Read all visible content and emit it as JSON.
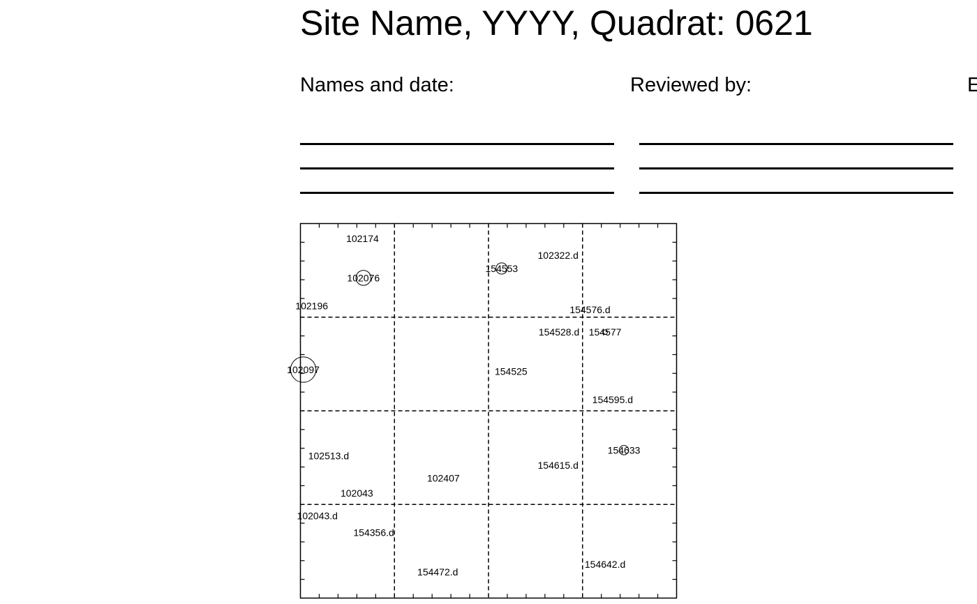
{
  "header": {
    "title": "Site Name, YYYY, Quadrat: 0621",
    "names_label": "Names and date:",
    "reviewed_label": "Reviewed by:",
    "third_label_partial": "E"
  },
  "quadrat_map": {
    "extent": [
      0,
      20
    ],
    "cell_size": 5,
    "tick_spacing": 1,
    "grid_line_style": "dashed",
    "trees": [
      {
        "tag": "102174",
        "x": 3.3,
        "y": 19.2,
        "dbh": 0
      },
      {
        "tag": "102076",
        "x": 3.35,
        "y": 17.1,
        "dbh": 0.8
      },
      {
        "tag": "102196",
        "x": 0.6,
        "y": 15.6,
        "dbh": 0
      },
      {
        "tag": "154553",
        "x": 10.7,
        "y": 17.6,
        "dbh": 0.6
      },
      {
        "tag": "102322.d",
        "x": 13.7,
        "y": 18.3,
        "dbh": 0
      },
      {
        "tag": "154576.d",
        "x": 15.4,
        "y": 15.4,
        "dbh": 0
      },
      {
        "tag": "154528.d",
        "x": 13.75,
        "y": 14.2,
        "dbh": 0
      },
      {
        "tag": "154577",
        "x": 16.2,
        "y": 14.2,
        "dbh": 0.25
      },
      {
        "tag": "102097",
        "x": 0.15,
        "y": 12.2,
        "dbh": 1.35
      },
      {
        "tag": "154525",
        "x": 11.2,
        "y": 12.1,
        "dbh": 0
      },
      {
        "tag": "154595.d",
        "x": 16.6,
        "y": 10.6,
        "dbh": 0
      },
      {
        "tag": "154633",
        "x": 17.2,
        "y": 7.9,
        "dbh": 0.5
      },
      {
        "tag": "102513.d",
        "x": 1.5,
        "y": 7.6,
        "dbh": 0
      },
      {
        "tag": "154615.d",
        "x": 13.7,
        "y": 7.1,
        "dbh": 0
      },
      {
        "tag": "102407",
        "x": 7.6,
        "y": 6.4,
        "dbh": 0
      },
      {
        "tag": "102043",
        "x": 3.0,
        "y": 5.6,
        "dbh": 0
      },
      {
        "tag": "102043.d",
        "x": 0.9,
        "y": 4.4,
        "dbh": 0
      },
      {
        "tag": "154356.d",
        "x": 3.9,
        "y": 3.5,
        "dbh": 0
      },
      {
        "tag": "154472.d",
        "x": 7.3,
        "y": 1.4,
        "dbh": 0
      },
      {
        "tag": "154642.d",
        "x": 16.2,
        "y": 1.8,
        "dbh": 0
      }
    ]
  }
}
